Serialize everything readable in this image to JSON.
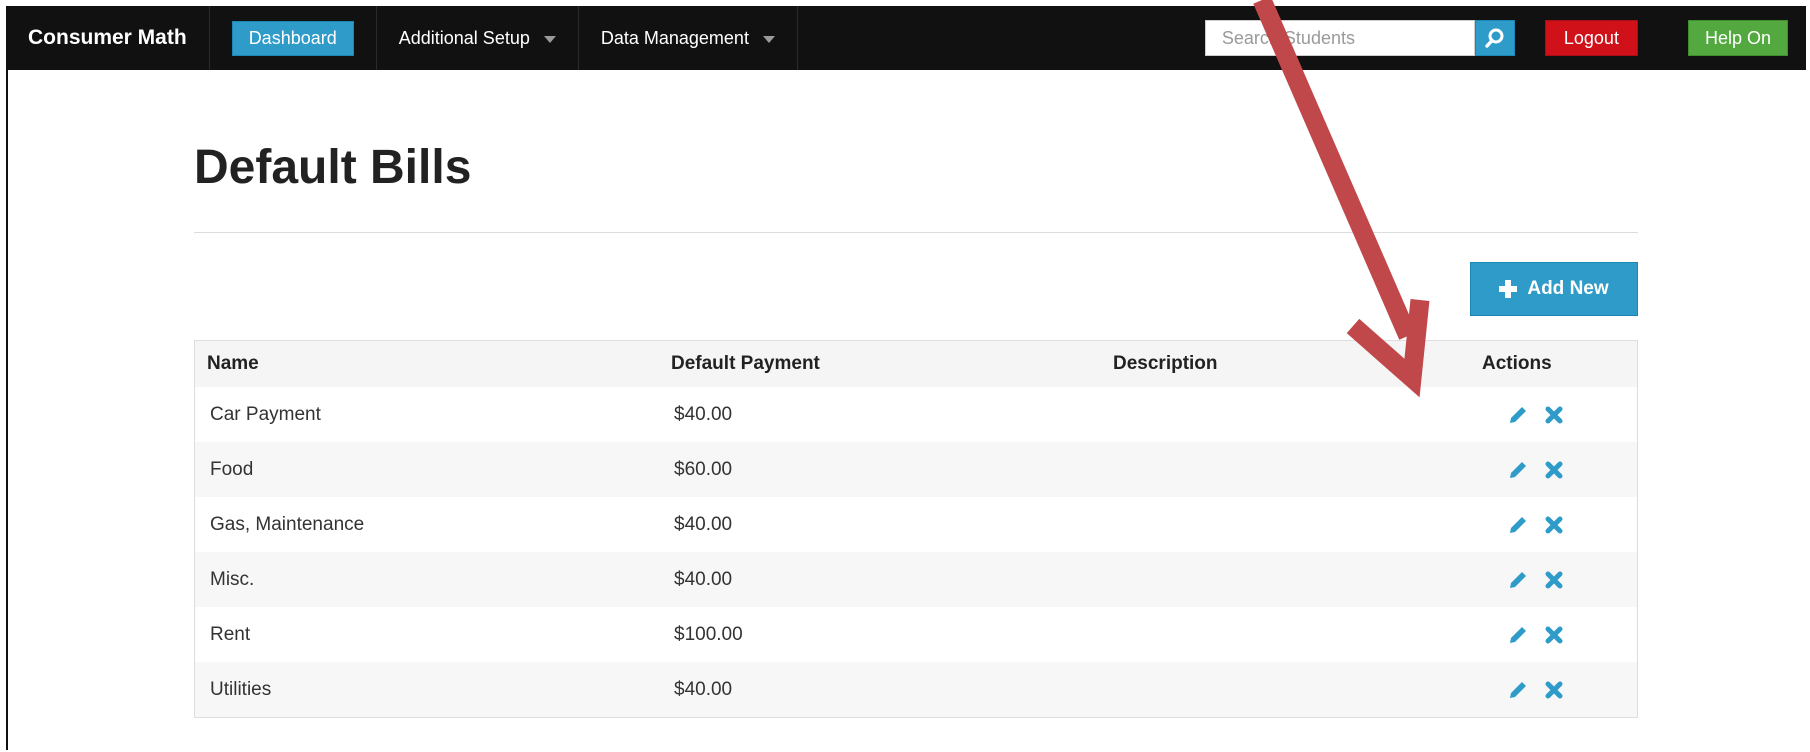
{
  "navbar": {
    "brand": "Consumer Math",
    "items": [
      {
        "label": "Dashboard",
        "active": true,
        "dropdown": false
      },
      {
        "label": "Additional Setup",
        "active": false,
        "dropdown": true
      },
      {
        "label": "Data Management",
        "active": false,
        "dropdown": true
      }
    ],
    "search": {
      "placeholder": "Search Students",
      "value": ""
    },
    "logout_label": "Logout",
    "help_label": "Help On"
  },
  "page": {
    "title": "Default Bills",
    "add_button_label": "Add New"
  },
  "table": {
    "columns": [
      "Name",
      "Default Payment",
      "Description",
      "Actions"
    ],
    "rows": [
      {
        "name": "Car Payment",
        "payment": "$40.00",
        "description": ""
      },
      {
        "name": "Food",
        "payment": "$60.00",
        "description": ""
      },
      {
        "name": "Gas, Maintenance",
        "payment": "$40.00",
        "description": ""
      },
      {
        "name": "Misc.",
        "payment": "$40.00",
        "description": ""
      },
      {
        "name": "Rent",
        "payment": "$100.00",
        "description": ""
      },
      {
        "name": "Utilities",
        "payment": "$40.00",
        "description": ""
      }
    ]
  },
  "icons": {
    "search": "search-icon",
    "add": "plus-icon",
    "edit": "pencil-icon",
    "delete": "x-icon"
  },
  "colors": {
    "navbar_bg": "#111111",
    "accent_blue": "#2f9bc9",
    "logout_red": "#d0111a",
    "help_green": "#53a93f",
    "annotation_arrow": "#c0474a"
  }
}
